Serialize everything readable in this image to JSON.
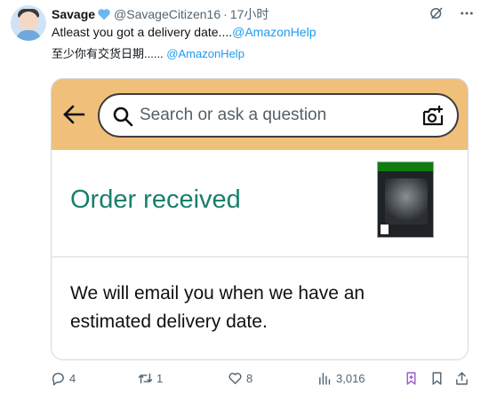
{
  "tweet": {
    "author_name": "Savage",
    "handle": "@SavageCitizen16",
    "separator": "·",
    "time": "17小时",
    "text_line1": "Atleast you got a delivery date....",
    "text_line1_mention": "@AmazonHelp",
    "translation_text": "至少你有交货日期...... ",
    "translation_mention": "@AmazonHelp"
  },
  "screenshot": {
    "search_placeholder": "Search or ask a question",
    "order_status": "Order received",
    "email_message": "We will email you when we have an estimated delivery date.",
    "banner_color": "#f0bf7a",
    "accent_color": "#17806c"
  },
  "actions": {
    "reply_count": "4",
    "retweet_count": "1",
    "like_count": "8",
    "views_count": "3,016"
  },
  "icons": [
    "verified-heart-icon",
    "grok-icon",
    "more-icon",
    "back-arrow-icon",
    "search-icon",
    "camera-icon",
    "reply-icon",
    "retweet-icon",
    "like-icon",
    "views-icon",
    "bookmark-icon",
    "share-icon"
  ]
}
